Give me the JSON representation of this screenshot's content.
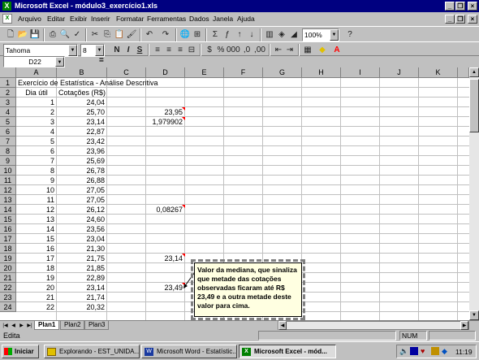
{
  "window": {
    "title": "Microsoft Excel - módulo3_exercício1.xls",
    "logo": "excel-x-logo",
    "app_logo_letter": "X",
    "controls": [
      "minimize",
      "restore",
      "close"
    ]
  },
  "menu": [
    "Arquivo",
    "Editar",
    "Exibir",
    "Inserir",
    "Formatar",
    "Ferramentas",
    "Dados",
    "Janela",
    "Ajuda"
  ],
  "formatting": {
    "font": "Tahoma",
    "size": "8",
    "bold": "N",
    "italic": "I",
    "underline": "S",
    "zoom": "100%"
  },
  "formula_bar": {
    "name_box": "D22",
    "equals": "=",
    "content": ""
  },
  "columns": [
    "A",
    "B",
    "C",
    "D",
    "E",
    "F",
    "G",
    "H",
    "I",
    "J",
    "K"
  ],
  "rows": [
    "1",
    "2",
    "3",
    "4",
    "5",
    "6",
    "7",
    "8",
    "9",
    "10",
    "11",
    "12",
    "13",
    "14",
    "15",
    "16",
    "17",
    "18",
    "19",
    "20",
    "21",
    "22",
    "23",
    "24"
  ],
  "cells": {
    "A1": "Exercício de Estatística - Análise Descritiva",
    "A2": "Dia útil",
    "B2": "Cotações (R$)",
    "colA": [
      "1",
      "2",
      "3",
      "4",
      "5",
      "6",
      "7",
      "8",
      "9",
      "10",
      "11",
      "12",
      "13",
      "14",
      "15",
      "16",
      "17",
      "18",
      "19",
      "20",
      "21",
      "22"
    ],
    "colB": [
      "24,04",
      "25,70",
      "23,14",
      "22,87",
      "23,42",
      "23,96",
      "25,69",
      "26,78",
      "26,88",
      "27,05",
      "27,05",
      "26,12",
      "24,60",
      "23,56",
      "23,04",
      "21,30",
      "21,75",
      "21,85",
      "22,89",
      "23,14",
      "21,74",
      "20,32"
    ],
    "D4": "23,95",
    "D5": "1,979902",
    "D14": "0,08267",
    "D19": "23,14",
    "D22": "23,49"
  },
  "comment": {
    "text": "Valor da mediana, que sinaliza que metade das cotações observadas ficaram até R$ 23,49 e a outra metade deste valor para cima."
  },
  "sheets": {
    "tabs": [
      "Plan1",
      "Plan2",
      "Plan3"
    ],
    "active": "Plan1"
  },
  "status": {
    "mode": "Edita",
    "numlock": "NUM"
  },
  "taskbar": {
    "start": "Iniciar",
    "buttons": [
      {
        "label": "Explorando - EST_UNIDA...",
        "icon": "folder-icon"
      },
      {
        "label": "Microsoft Word - Estatístic...",
        "icon": "word-icon"
      },
      {
        "label": "Microsoft Excel - mód...",
        "icon": "excel-icon"
      }
    ],
    "clock": "11:19"
  },
  "colors": {
    "title_bar": "#000080",
    "comment_bg": "#ffffe1",
    "comment_marker": "#ff0000"
  }
}
